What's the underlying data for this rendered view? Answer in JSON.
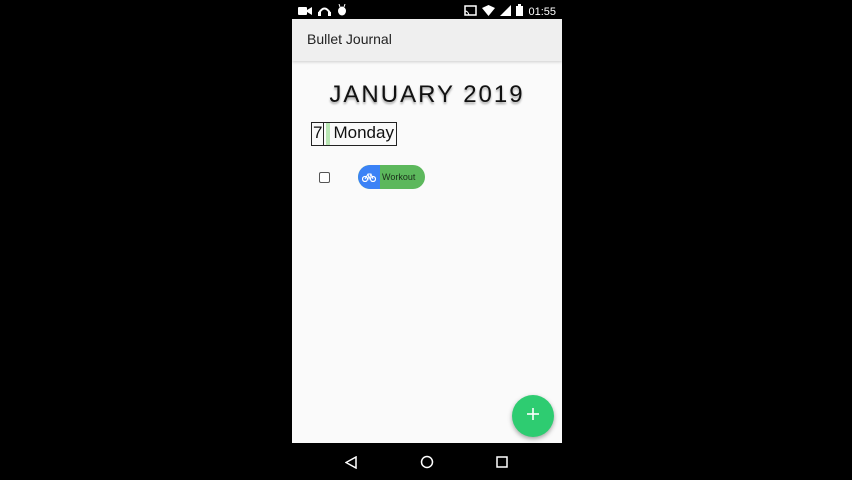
{
  "status_bar": {
    "time": "01:55",
    "icons": [
      "video-camera-icon",
      "headset-icon",
      "android-bug-icon",
      "cast-icon",
      "wifi-icon",
      "signal-icon",
      "battery-icon"
    ]
  },
  "app_bar": {
    "title": "Bullet Journal"
  },
  "journal": {
    "month_title": "JANUARY 2019",
    "day": {
      "number": "7",
      "name": "Monday",
      "accent_color": "#b9e6b4"
    },
    "tasks": [
      {
        "checked": false,
        "tag": {
          "label": "Workout",
          "icon": "bicycle-icon",
          "color": "#5cb85c",
          "icon_bg": "#3b82f6"
        }
      }
    ]
  },
  "fab": {
    "icon": "plus-icon",
    "color": "#2ecc71"
  },
  "nav_bar": {
    "buttons": [
      "back-icon",
      "home-icon",
      "recents-icon"
    ]
  }
}
